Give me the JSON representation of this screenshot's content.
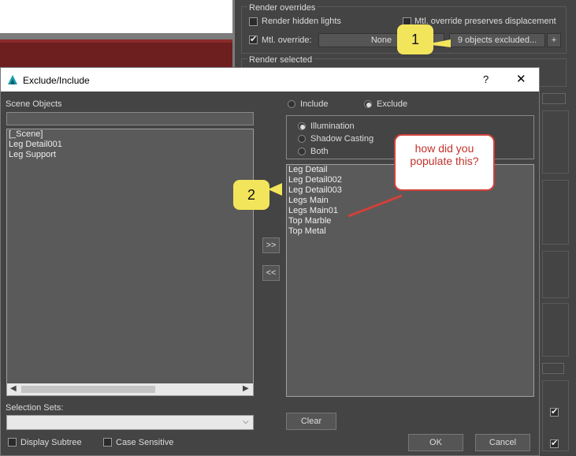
{
  "right_panel": {
    "render_overrides_title": "Render overrides",
    "render_hidden_lights": "Render hidden lights",
    "mtl_override_preserves": "Mtl. override preserves displacement",
    "mtl_override_label": "Mtl. override:",
    "mtl_override_value": "None",
    "objects_excluded": "9 objects excluded...",
    "plus_label": "+",
    "render_selected_title": "Render selected"
  },
  "dialog": {
    "title": "Exclude/Include",
    "help_label": "?",
    "close_label": "✕",
    "scene_objects_label": "Scene Objects",
    "scene_list": [
      "[_Scene]",
      "Leg Detail001",
      "Leg Support"
    ],
    "include_label": "Include",
    "exclude_label": "Exclude",
    "illumination_label": "Illumination",
    "shadow_casting_label": "Shadow Casting",
    "both_label": "Both",
    "excluded_list": [
      "Leg Detail",
      "Leg Detail002",
      "Leg Detail003",
      "Legs Main",
      "Legs Main01",
      "Top Marble",
      "Top Metal"
    ],
    "move_right_label": ">>",
    "move_left_label": "<<",
    "selection_sets_label": "Selection Sets:",
    "display_subtree_label": "Display Subtree",
    "case_sensitive_label": "Case Sensitive",
    "clear_label": "Clear",
    "ok_label": "OK",
    "cancel_label": "Cancel"
  },
  "annotations": {
    "callout1": "1",
    "callout2": "2",
    "speech": "how did you populate this?"
  },
  "colors": {
    "callout_yellow": "#f3e55b",
    "speech_border": "#d0413a"
  }
}
